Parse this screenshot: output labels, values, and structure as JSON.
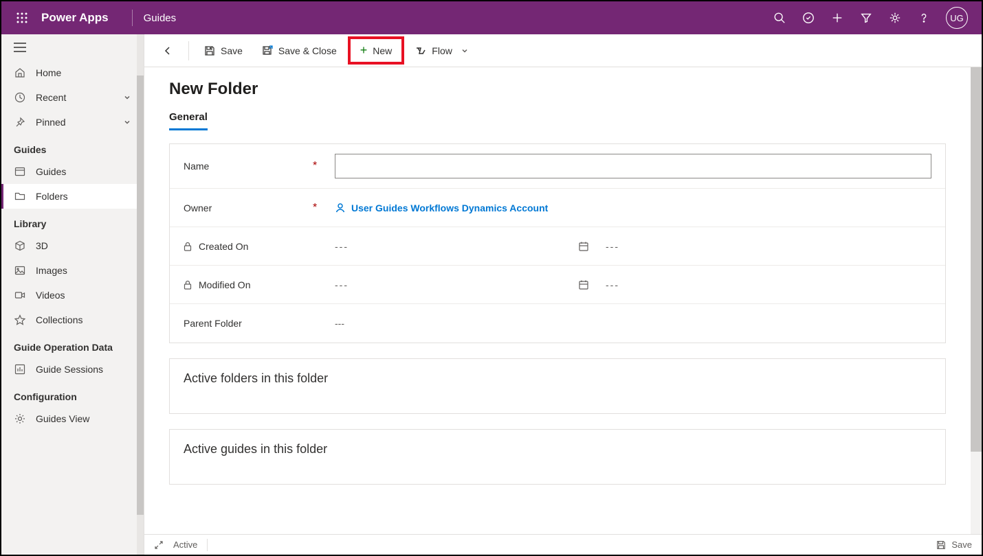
{
  "header": {
    "app_name": "Power Apps",
    "env_name": "Guides",
    "avatar_initials": "UG"
  },
  "sidebar": {
    "root": [
      {
        "label": "Home",
        "icon": "home"
      },
      {
        "label": "Recent",
        "icon": "clock",
        "chev": true
      },
      {
        "label": "Pinned",
        "icon": "pin",
        "chev": true
      }
    ],
    "groups": [
      {
        "title": "Guides",
        "items": [
          {
            "label": "Guides",
            "icon": "window"
          },
          {
            "label": "Folders",
            "icon": "folder",
            "active": true
          }
        ]
      },
      {
        "title": "Library",
        "items": [
          {
            "label": "3D",
            "icon": "cube"
          },
          {
            "label": "Images",
            "icon": "image"
          },
          {
            "label": "Videos",
            "icon": "video"
          },
          {
            "label": "Collections",
            "icon": "star"
          }
        ]
      },
      {
        "title": "Guide Operation Data",
        "items": [
          {
            "label": "Guide Sessions",
            "icon": "chart"
          }
        ]
      },
      {
        "title": "Configuration",
        "items": [
          {
            "label": "Guides View",
            "icon": "gear"
          }
        ]
      }
    ]
  },
  "cmd": {
    "save": "Save",
    "save_close": "Save & Close",
    "new": "New",
    "flow": "Flow"
  },
  "page": {
    "title": "New Folder",
    "tab_general": "General"
  },
  "form": {
    "name_label": "Name",
    "name_value": "",
    "owner_label": "Owner",
    "owner_value": "User Guides Workflows Dynamics Account",
    "created_label": "Created On",
    "created_date": "---",
    "created_time": "---",
    "modified_label": "Modified On",
    "modified_date": "---",
    "modified_time": "---",
    "parent_label": "Parent Folder",
    "parent_value": "---"
  },
  "sections": {
    "active_folders": "Active folders in this folder",
    "active_guides": "Active guides in this folder"
  },
  "status": {
    "state": "Active",
    "save": "Save"
  }
}
